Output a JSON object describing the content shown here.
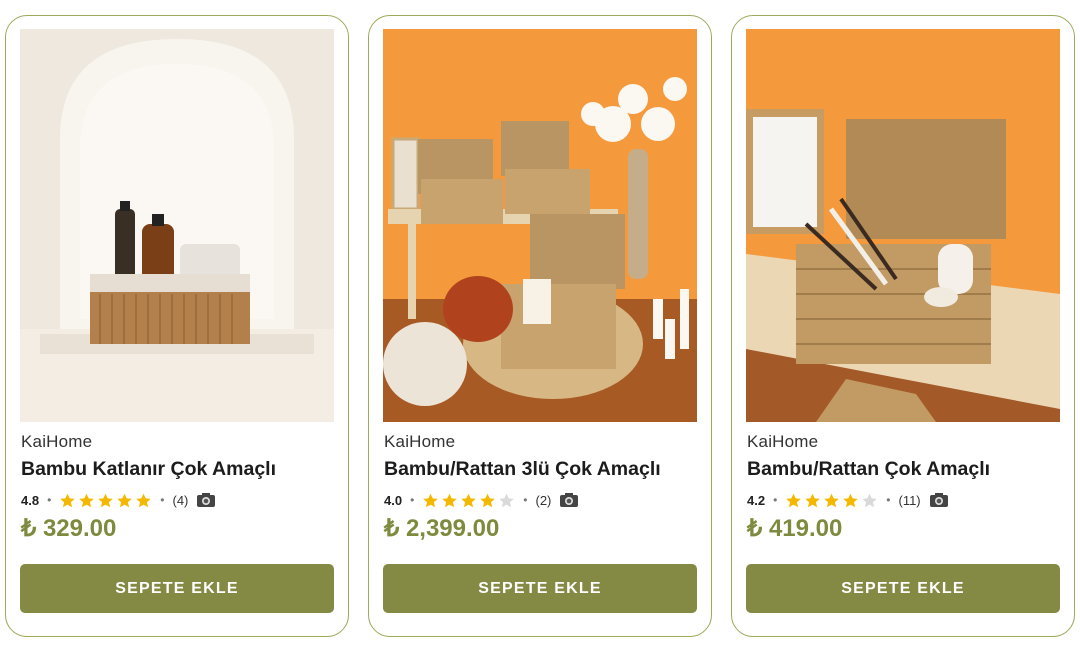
{
  "products": [
    {
      "brand": "KaiHome",
      "title": "Bambu Katlanır Çok Amaçlı",
      "rating": "4.8",
      "stars_filled": 5,
      "reviews": "(4)",
      "price": "₺ 329.00",
      "button": "SEPETE EKLE",
      "image_icon": "bamboo-basket-photo"
    },
    {
      "brand": "KaiHome",
      "title": "Bambu/Rattan 3lü Çok Amaçlı",
      "rating": "4.0",
      "stars_filled": 4,
      "reviews": "(2)",
      "price": "₺ 2,399.00",
      "button": "SEPETE EKLE",
      "image_icon": "rattan-baskets-photo"
    },
    {
      "brand": "KaiHome",
      "title": "Bambu/Rattan Çok Amaçlı",
      "rating": "4.2",
      "stars_filled": 4,
      "reviews": "(11)",
      "price": "₺ 419.00",
      "button": "SEPETE EKLE",
      "image_icon": "rattan-basket-photo"
    }
  ],
  "colors": {
    "accent": "#848a44",
    "price": "#7e8a3e",
    "border": "#9aab5a",
    "star_on": "#f5b800",
    "star_off": "#d9d9d9"
  }
}
